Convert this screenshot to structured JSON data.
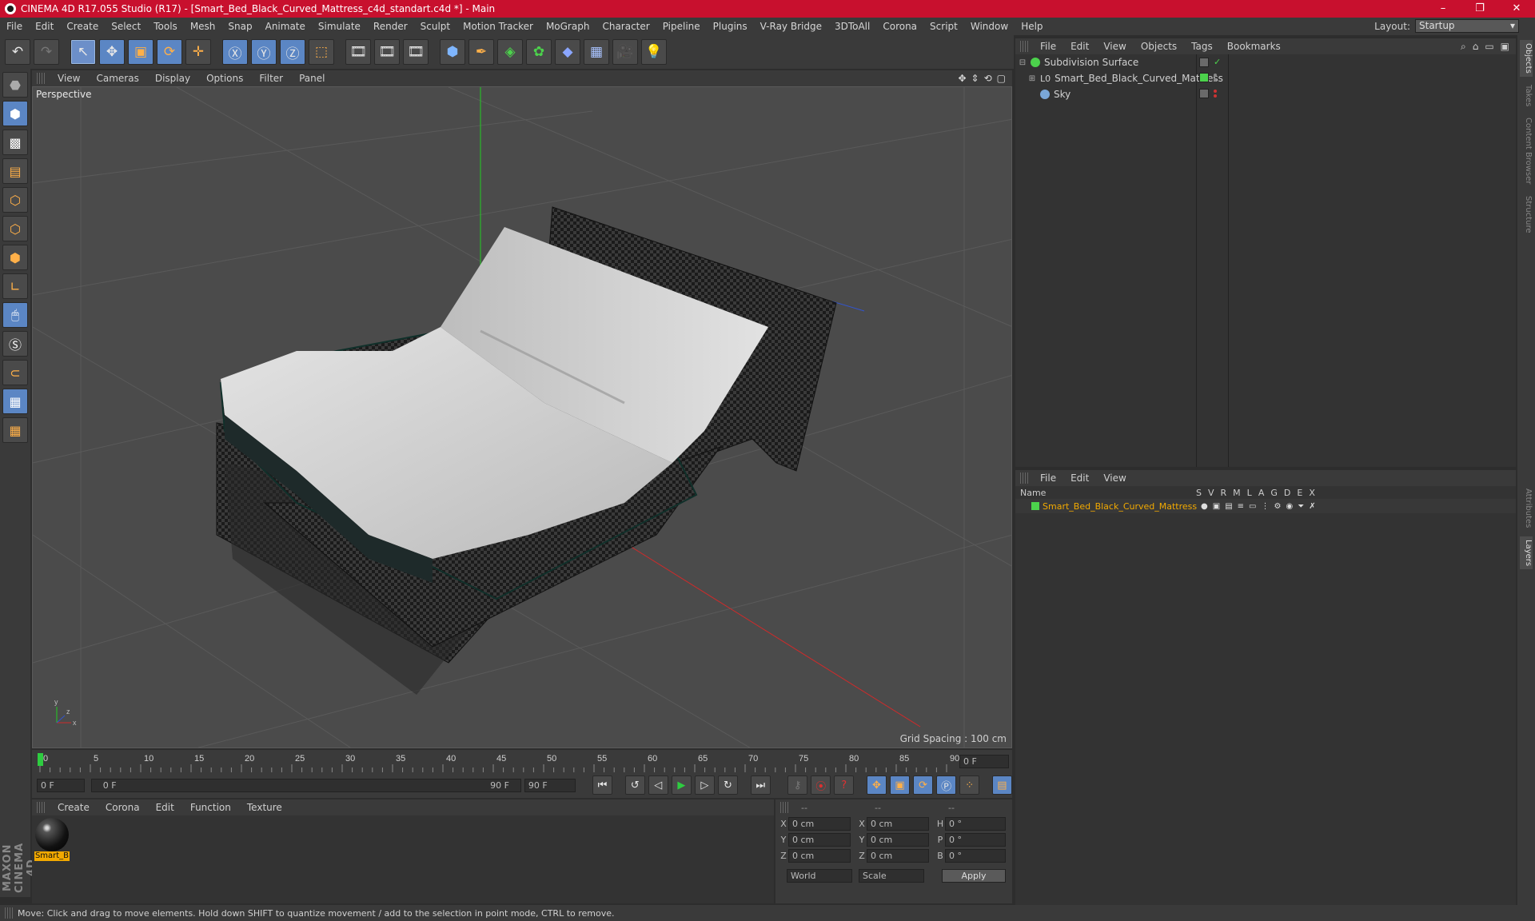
{
  "window": {
    "title": "CINEMA 4D R17.055 Studio (R17) - [Smart_Bed_Black_Curved_Mattress_c4d_standart.c4d *] - Main",
    "minimize": "–",
    "maximize": "❐",
    "close": "✕"
  },
  "menubar": {
    "items": [
      "File",
      "Edit",
      "Create",
      "Select",
      "Tools",
      "Mesh",
      "Snap",
      "Animate",
      "Simulate",
      "Render",
      "Sculpt",
      "Motion Tracker",
      "MoGraph",
      "Character",
      "Pipeline",
      "Plugins",
      "V-Ray Bridge",
      "3DToAll",
      "Corona",
      "Script",
      "Window",
      "Help"
    ],
    "layout_label": "Layout:",
    "layout_value": "Startup"
  },
  "viewport": {
    "menu": [
      "View",
      "Cameras",
      "Display",
      "Options",
      "Filter",
      "Panel"
    ],
    "label": "Perspective",
    "grid_spacing": "Grid Spacing : 100 cm"
  },
  "timeline": {
    "ticks": [
      "0",
      "5",
      "10",
      "15",
      "20",
      "25",
      "30",
      "35",
      "40",
      "45",
      "50",
      "55",
      "60",
      "65",
      "70",
      "75",
      "80",
      "85",
      "90"
    ],
    "current_frame": "0 F"
  },
  "playback": {
    "start": "0 F",
    "range_start": "0 F",
    "range_end": "90 F",
    "end": "90 F"
  },
  "materials": {
    "menu": [
      "Create",
      "Corona",
      "Edit",
      "Function",
      "Texture"
    ],
    "items": [
      {
        "label": "Smart_B"
      }
    ]
  },
  "coords": {
    "headers": [
      "--",
      "--",
      "--"
    ],
    "rows": [
      {
        "a1": "X",
        "v1": "0 cm",
        "a2": "X",
        "v2": "0 cm",
        "a3": "H",
        "v3": "0 °"
      },
      {
        "a1": "Y",
        "v1": "0 cm",
        "a2": "Y",
        "v2": "0 cm",
        "a3": "P",
        "v3": "0 °"
      },
      {
        "a1": "Z",
        "v1": "0 cm",
        "a2": "Z",
        "v2": "0 cm",
        "a3": "B",
        "v3": "0 °"
      }
    ],
    "space": "World",
    "mode": "Scale",
    "apply": "Apply"
  },
  "objects": {
    "menu": [
      "File",
      "Edit",
      "View",
      "Objects",
      "Tags",
      "Bookmarks"
    ],
    "items": [
      {
        "name": "Subdivision Surface",
        "color": "#4cd24c"
      },
      {
        "name": "Smart_Bed_Black_Curved_Mattress",
        "color": "#f2a900"
      },
      {
        "name": "Sky",
        "color": "#7aa7d8"
      }
    ]
  },
  "layers": {
    "menu": [
      "File",
      "Edit",
      "View"
    ],
    "header_name": "Name",
    "columns": [
      "S",
      "V",
      "R",
      "M",
      "L",
      "A",
      "G",
      "D",
      "E",
      "X"
    ],
    "rows": [
      {
        "name": "Smart_Bed_Black_Curved_Mattress",
        "color": "#4cd24c"
      }
    ]
  },
  "right_tabs": [
    "Objects",
    "Takes",
    "Content Browser",
    "Structure",
    "Attributes",
    "Layers"
  ],
  "brand": "MAXON CINEMA 4D",
  "status": "Move: Click and drag to move elements. Hold down SHIFT to quantize movement / add to the selection in point mode, CTRL to remove."
}
